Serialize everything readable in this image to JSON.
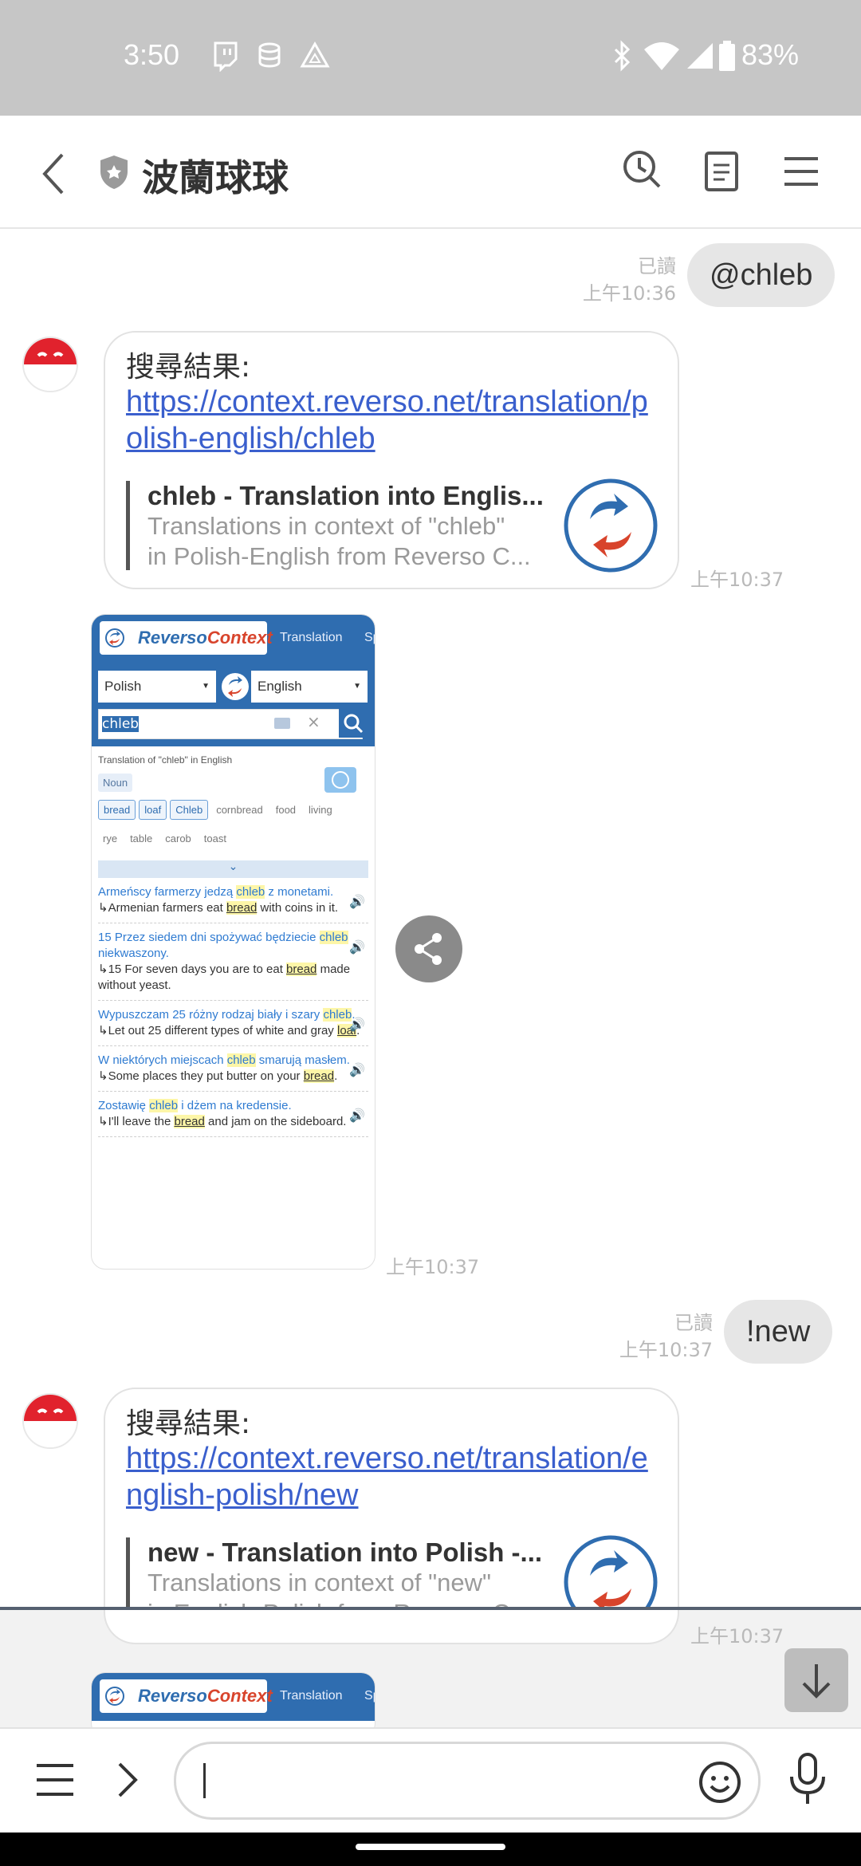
{
  "status_bar": {
    "time": "3:50",
    "battery": "83%",
    "icons": [
      "twitch-icon",
      "database-icon",
      "drive-icon",
      "bluetooth-icon",
      "wifi-icon",
      "signal-icon",
      "battery-icon"
    ]
  },
  "header": {
    "title": "波蘭球球",
    "icons": [
      "back-icon",
      "shield-icon",
      "history-icon",
      "notes-icon",
      "menu-icon"
    ]
  },
  "messages": {
    "m1": {
      "read": "已讀",
      "time": "上午10:36",
      "text": "@chleb"
    },
    "m2": {
      "head": "搜尋結果:",
      "link": "https://context.reverso.net/translation/polish-english/chleb",
      "preview_title": "chleb - Translation into Englis...",
      "preview_desc1": "Translations in context of \"chleb\"",
      "preview_desc2": "in Polish-English from Reverso C...",
      "time": "上午10:37"
    },
    "m3": {
      "time": "上午10:37",
      "shot": {
        "brand_a": "Reverso",
        "brand_b": "Context",
        "tab": "Translation",
        "tab2": "Sp",
        "from_lang": "Polish",
        "to_lang": "English",
        "query": "chleb",
        "heading": "Translation of \"chleb\" in English",
        "pos": "Noun",
        "chips_main": [
          "bread",
          "loaf",
          "Chleb"
        ],
        "chips_other": [
          "cornbread",
          "food",
          "living"
        ],
        "chips_row2": [
          "rye",
          "table",
          "carob",
          "toast"
        ],
        "examples": [
          {
            "pl_a": "Armeńscy farmerzy jedzą ",
            "pl_hl": "chleb",
            "pl_b": " z monetami.",
            "en_a": "↳Armenian farmers eat ",
            "en_hl": "bread",
            "en_b": " with coins in it."
          },
          {
            "pl_a": "15 Przez siedem dni spożywać będziecie ",
            "pl_hl": "chleb",
            "pl_b": " niekwaszony.",
            "en_a": "↳15 For seven days you are to eat ",
            "en_hl": "bread",
            "en_b": " made without yeast."
          },
          {
            "pl_a": "Wypuszczam 25 różny rodzaj biały i szary ",
            "pl_hl": "chleb",
            "pl_b": ".",
            "en_a": "↳Let out 25 different types of white and gray ",
            "en_hl": "loaf",
            "en_b": "."
          },
          {
            "pl_a": "W niektórych miejscach ",
            "pl_hl": "chleb",
            "pl_b": " smarują masłem.",
            "en_a": "↳Some places they put butter on your ",
            "en_hl": "bread",
            "en_b": "."
          },
          {
            "pl_a": "Zostawię ",
            "pl_hl": "chleb",
            "pl_b": " i dżem na kredensie.",
            "en_a": "↳I'll leave the ",
            "en_hl": "bread",
            "en_b": " and jam on the sideboard."
          }
        ]
      }
    },
    "m4": {
      "read": "已讀",
      "time": "上午10:37",
      "text": "!new"
    },
    "m5": {
      "head": "搜尋結果:",
      "link": "https://context.reverso.net/translation/english-polish/new",
      "preview_title": "new - Translation into Polish -...",
      "preview_desc1": "Translations in context of \"new\"",
      "preview_desc2": "in English-Polish from Reverso C...",
      "time": "上午10:37"
    },
    "m6": {
      "brand_a": "Reverso",
      "brand_b": "Context",
      "tab": "Translation",
      "tab2": "Sp"
    }
  },
  "input_bar": {
    "placeholder": "",
    "icons": [
      "menu-icon",
      "expand-icon",
      "emoji-icon",
      "mic-icon"
    ]
  },
  "colors": {
    "link": "#3a5fcd",
    "reverso_blue": "#2f6db0",
    "reverso_red": "#d8442c",
    "bubble_gray": "#e6e6e6"
  }
}
